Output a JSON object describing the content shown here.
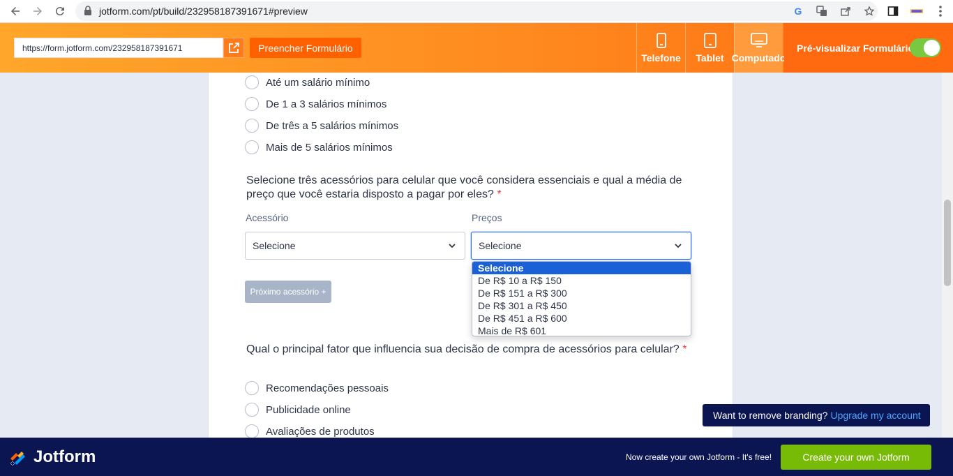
{
  "browser": {
    "url": "jotform.com/pt/build/232958187391671#preview"
  },
  "toolbar": {
    "share_url": "https://form.jotform.com/232958187391671",
    "fill_button": "Preencher Formulário",
    "devices": [
      {
        "label": "Telefone"
      },
      {
        "label": "Tablet"
      },
      {
        "label": "Computado"
      }
    ],
    "preview_label": "Pré-visualizar Formulário"
  },
  "form": {
    "income_options": [
      "Até um salário mínimo",
      "De 1 a 3 salários mínimos",
      "De três a 5 salários mínimos",
      "Mais de 5 salários mínimos"
    ],
    "accessory_question": "Selecione três acessórios para celular que você considera essenciais e qual a média de preço que você estaria disposto a pagar por eles?",
    "required_mark": "*",
    "col_accessory": "Acessório",
    "col_prices": "Preços",
    "accessory_select": "Selecione",
    "price_select": "Selecione",
    "price_options": [
      "Selecione",
      "De R$ 10 a R$ 150",
      "De R$ 151 a R$ 300",
      "De R$ 301 a R$ 450",
      "De R$ 451 a R$ 600",
      "Mais de R$ 601"
    ],
    "next_button": "Próximo acessório +",
    "factor_question": "Qual o principal fator que influencia sua decisão de compra de acessórios para celular?",
    "factor_options": [
      "Recomendações pessoais",
      "Publicidade online",
      "Avaliações de produtos"
    ]
  },
  "branding": {
    "text": "Want to remove branding?",
    "link": "Upgrade my account"
  },
  "footer": {
    "logo": "Jotform",
    "text": "Now create your own Jotform - It's free!",
    "button": "Create your own Jotform"
  }
}
